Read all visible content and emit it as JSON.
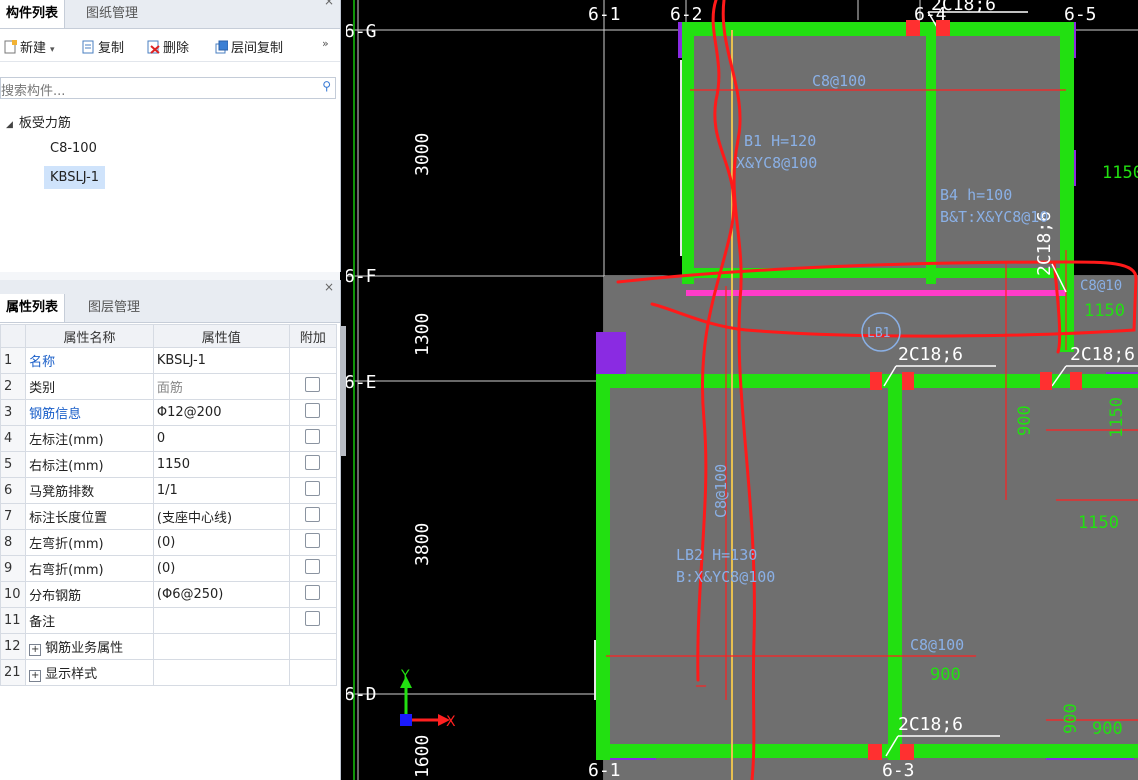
{
  "top_panel": {
    "tabs": [
      "构件列表",
      "图纸管理"
    ],
    "close": "×",
    "toolbar": {
      "new": "新建",
      "copy": "复制",
      "delete": "删除",
      "floor_copy": "层间复制",
      "more": "»"
    },
    "search_placeholder": "搜索构件...",
    "tree": {
      "group": "板受力筋",
      "items": [
        "C8-100",
        "KBSLJ-1"
      ]
    }
  },
  "bottom_panel": {
    "tabs": [
      "属性列表",
      "图层管理"
    ],
    "close": "×",
    "headers": [
      "属性名称",
      "属性值",
      "附加"
    ],
    "rows": [
      {
        "n": "1",
        "name": "名称",
        "value": "KBSLJ-1"
      },
      {
        "n": "2",
        "name": "类别",
        "value": "面筋"
      },
      {
        "n": "3",
        "name": "钢筋信息",
        "value": "Φ12@200"
      },
      {
        "n": "4",
        "name": "左标注(mm)",
        "value": "0"
      },
      {
        "n": "5",
        "name": "右标注(mm)",
        "value": "1150"
      },
      {
        "n": "6",
        "name": "马凳筋排数",
        "value": "1/1"
      },
      {
        "n": "7",
        "name": "标注长度位置",
        "value": "(支座中心线)"
      },
      {
        "n": "8",
        "name": "左弯折(mm)",
        "value": "(0)"
      },
      {
        "n": "9",
        "name": "右弯折(mm)",
        "value": "(0)"
      },
      {
        "n": "10",
        "name": "分布钢筋",
        "value": "(Φ6@250)"
      },
      {
        "n": "11",
        "name": "备注",
        "value": ""
      },
      {
        "n": "12",
        "name": "钢筋业务属性",
        "value": ""
      },
      {
        "n": "21",
        "name": "显示样式",
        "value": ""
      }
    ],
    "plus": "+"
  },
  "cad": {
    "axis_h": [
      "6-G",
      "6-F",
      "6-E",
      "6-D"
    ],
    "axis_v_top": [
      "6-1",
      "6-2",
      "6-4",
      "6-5"
    ],
    "axis_v_bottom": [
      "6-1",
      "6-3"
    ],
    "dims": [
      "3000",
      "1300",
      "3800",
      "1600"
    ],
    "labels": {
      "c8_100_top": "C8@100",
      "b1_h": "B1 H=120",
      "b1_r": "X&YC8@100",
      "b4_h": "B4 h=100",
      "b4_r": "B&T:X&YC8@10",
      "top_2c18": "2C18;6",
      "mid_2c18a": "2C18;6",
      "mid_2c18b": "2C18;6",
      "bot_2c18": "2C18;6",
      "vert_2c18": "2C18;6",
      "c8_r1": "C8@10",
      "lb1": "LB1",
      "lb2_h": "LB2 H=130",
      "lb2_r": "B:X&YC8@100",
      "c8_vert": "C8@100",
      "c8_bottom": "C8@100",
      "n1150a": "1150",
      "n1150b": "1150",
      "n1150c": "1150",
      "n1150d": "1150",
      "n900a": "900",
      "n900b": "900",
      "n900c": "900",
      "n900d": "900"
    },
    "ucs": {
      "y": "Y",
      "x": "X"
    }
  }
}
